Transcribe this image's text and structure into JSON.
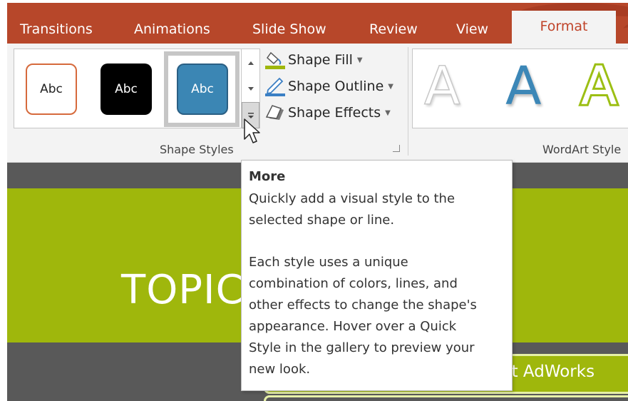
{
  "tabs": {
    "items": [
      "Transitions",
      "Animations",
      "Slide Show",
      "Review",
      "View"
    ],
    "active": "Format"
  },
  "shape_styles": {
    "thumbnails": [
      "Abc",
      "Abc",
      "Abc"
    ],
    "commands": {
      "fill": "Shape Fill",
      "outline": "Shape Outline",
      "effects": "Shape Effects"
    },
    "group_label": "Shape Styles"
  },
  "wordart": {
    "samples": [
      "A",
      "A",
      "A"
    ],
    "group_label": "WordArt Style"
  },
  "slide": {
    "title": "TOPIC",
    "box_text": "ut AdWorks"
  },
  "tooltip": {
    "title": "More",
    "line1": "Quickly add a visual style to the",
    "line2": "selected shape or line.",
    "line3": "Each style uses a unique",
    "line4": "combination of colors, lines, and",
    "line5": "other effects to change the shape's",
    "line6": "appearance. Hover over a Quick",
    "line7": "Style in the gallery to preview your",
    "line8": "new look."
  },
  "colors": {
    "tab_bar": "#b7472a",
    "ribbon": "#f3f3f3",
    "slide_green": "#9fb70c",
    "slide_gray": "#595959",
    "style_blue": "#3b86b4"
  }
}
